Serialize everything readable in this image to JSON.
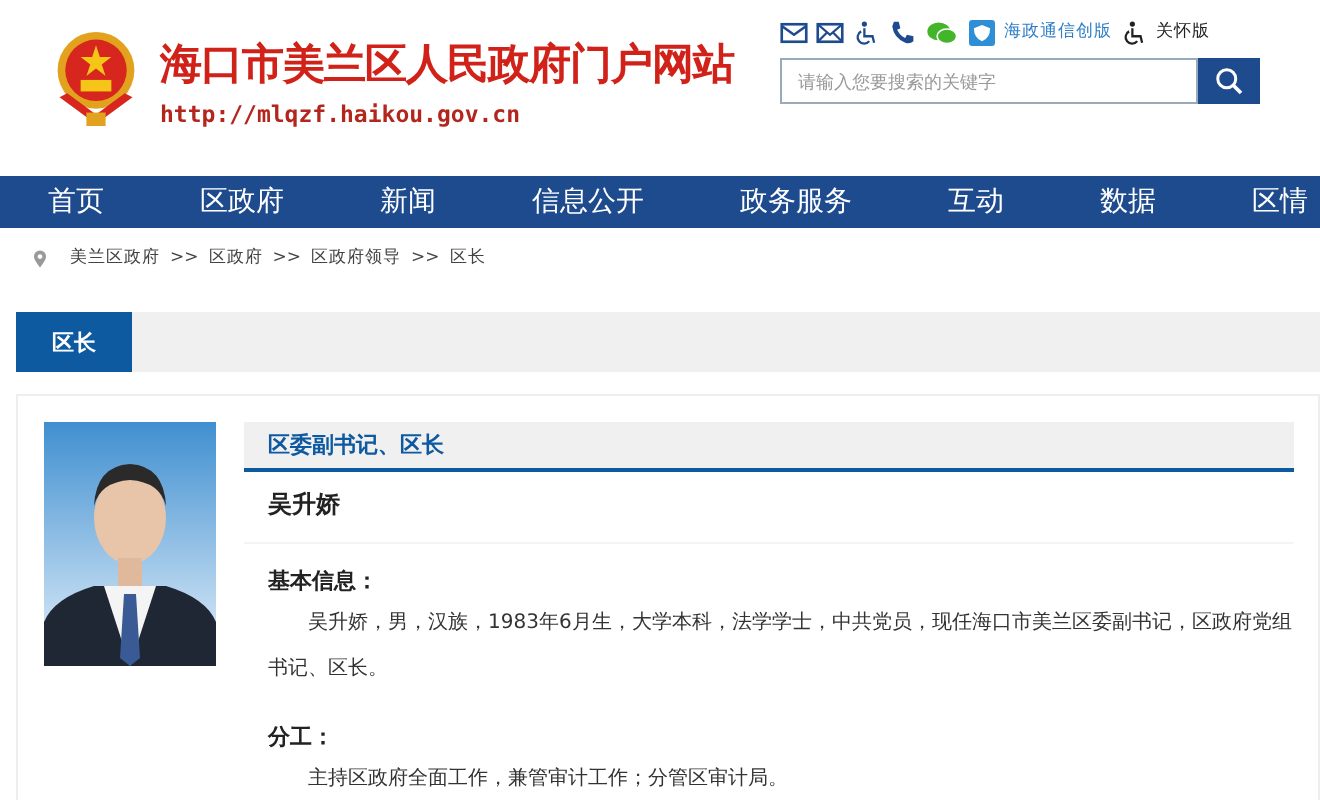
{
  "header": {
    "title": "海口市美兰区人民政府门户网站",
    "url": "http://mlqzf.haikou.gov.cn"
  },
  "toolbar": {
    "app_link": "海政通信创版",
    "care_link": "关怀版"
  },
  "search": {
    "placeholder": "请输入您要搜索的关键字"
  },
  "nav": [
    "首页",
    "区政府",
    "新闻",
    "信息公开",
    "政务服务",
    "互动",
    "数据",
    "区情"
  ],
  "breadcrumb": [
    "美兰区政府",
    "区政府",
    "区政府领导",
    "区长"
  ],
  "breadcrumb_separator": ">>",
  "tabs": [
    {
      "label": "区长",
      "selected": true
    }
  ],
  "profile": {
    "position": "区委副书记、区长",
    "name": "吴升娇",
    "sections": [
      {
        "heading": "基本信息：",
        "text": "吴升娇，男，汉族，1983年6月生，大学本科，法学学士，中共党员，现任海口市美兰区委副书记，区政府党组书记、区长。"
      },
      {
        "heading": "分工：",
        "text": "主持区政府全面工作，兼管审计工作；分管区审计局。"
      }
    ]
  }
}
